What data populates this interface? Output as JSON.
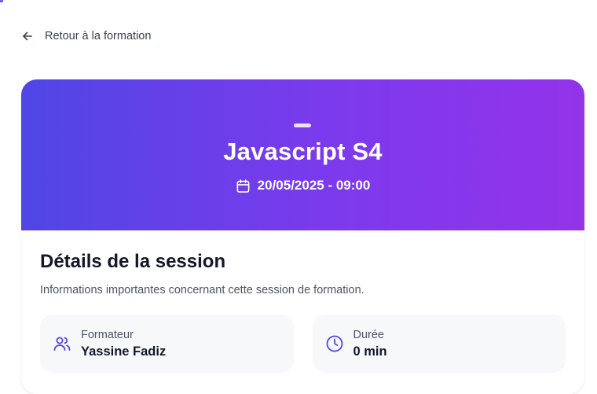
{
  "navigation": {
    "back_label": "Retour à la formation"
  },
  "session": {
    "title": "Javascript S4",
    "datetime": "20/05/2025 - 09:00"
  },
  "details": {
    "heading": "Détails de la session",
    "subtitle": "Informations importantes concernant cette session de formation.",
    "items": [
      {
        "label": "Formateur",
        "value": "Yassine Fadiz",
        "icon": "users-icon"
      },
      {
        "label": "Durée",
        "value": "0 min",
        "icon": "clock-icon"
      }
    ]
  },
  "colors": {
    "gradient_start": "#4f46e5",
    "gradient_end": "#9333ea",
    "icon_accent": "#4f46e5"
  }
}
